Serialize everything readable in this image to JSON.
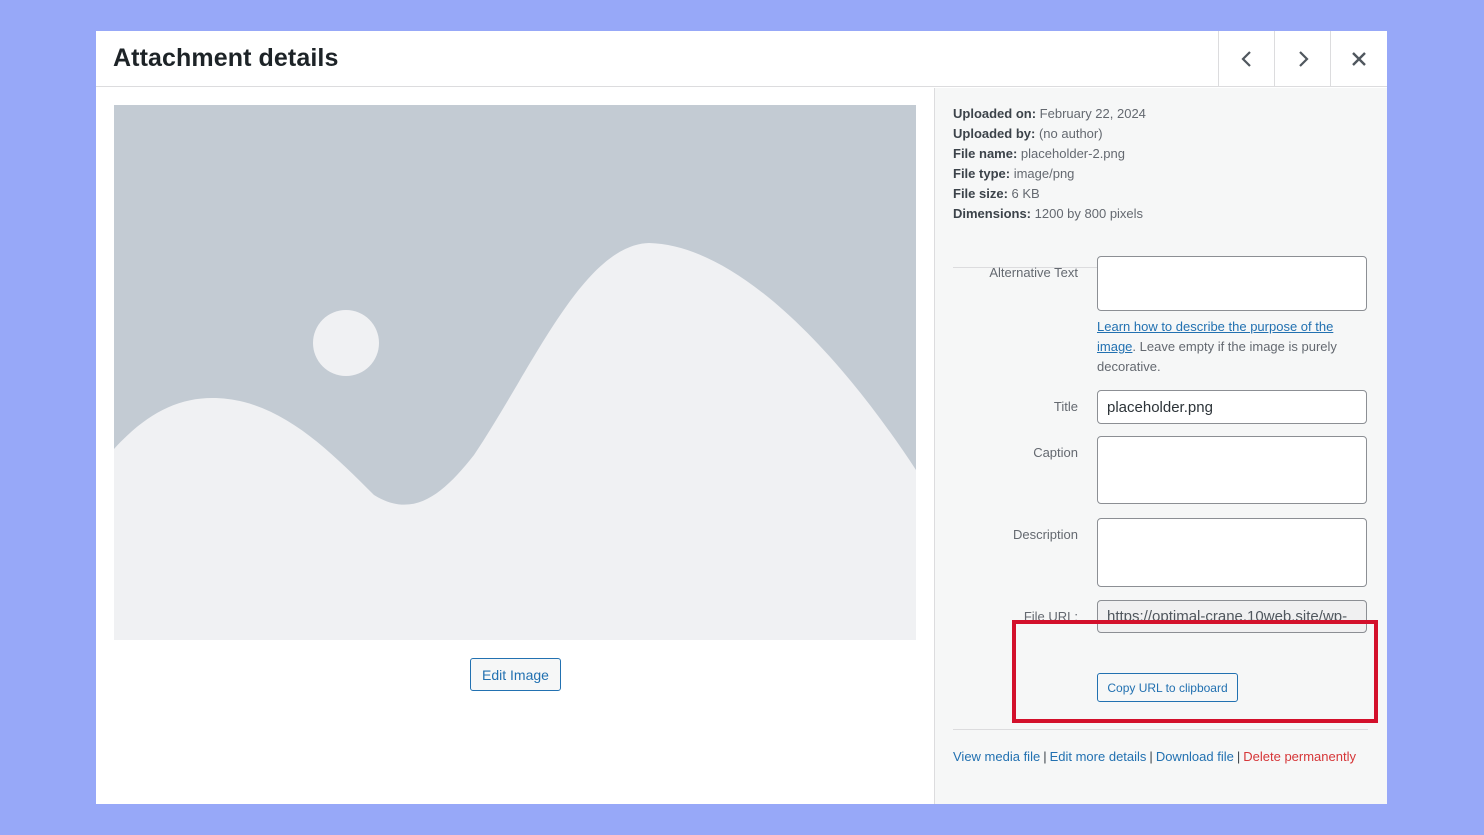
{
  "modal": {
    "title": "Attachment details",
    "prev_icon": "chevron-left-icon",
    "next_icon": "chevron-right-icon",
    "close_icon": "close-icon"
  },
  "preview": {
    "edit_button_label": "Edit Image",
    "colors": {
      "sky": "#c3cbd3",
      "ground": "#f0f1f3"
    }
  },
  "details": {
    "uploaded_on": {
      "label": "Uploaded on:",
      "value": "February 22, 2024"
    },
    "uploaded_by": {
      "label": "Uploaded by:",
      "value": "(no author)"
    },
    "file_name": {
      "label": "File name:",
      "value": "placeholder-2.png"
    },
    "file_type": {
      "label": "File type:",
      "value": "image/png"
    },
    "file_size": {
      "label": "File size:",
      "value": "6 KB"
    },
    "dimensions": {
      "label": "Dimensions:",
      "value": "1200 by 800 pixels"
    }
  },
  "form": {
    "alt_text": {
      "label": "Alternative Text",
      "value": ""
    },
    "alt_help": {
      "link": "Learn how to describe the purpose of the image",
      "text": ". Leave empty if the image is purely decorative."
    },
    "title": {
      "label": "Title",
      "value": "placeholder.png"
    },
    "caption": {
      "label": "Caption",
      "value": ""
    },
    "description": {
      "label": "Description",
      "value": ""
    },
    "file_url": {
      "label": "File URL:",
      "value": "https://optimal-crane.10web.site/wp-"
    },
    "copy_button_label": "Copy URL to clipboard"
  },
  "actions": {
    "view": "View media file",
    "edit": "Edit more details",
    "download": "Download file",
    "delete": "Delete permanently",
    "separator": "|"
  },
  "colors": {
    "background": "#97a8f8",
    "link": "#2271b1",
    "danger": "#d63638",
    "highlight": "#d3102b"
  }
}
